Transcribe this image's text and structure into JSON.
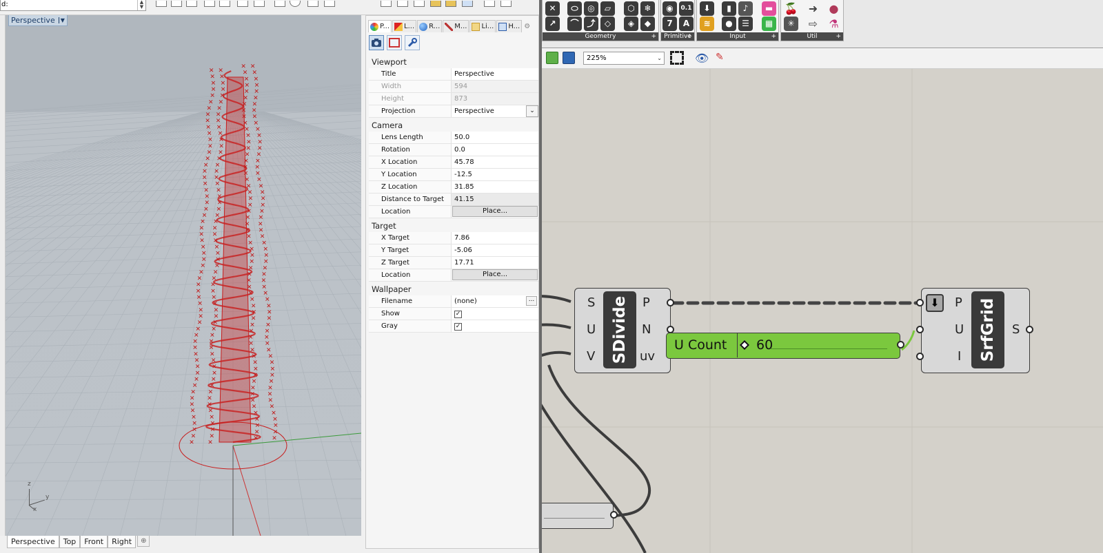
{
  "rhino": {
    "command_label": "d:",
    "viewport": {
      "title": "Perspective",
      "tabs": [
        "Perspective",
        "Top",
        "Front",
        "Right"
      ],
      "tab_add": "⊕",
      "axis": {
        "z": "z",
        "y": "y",
        "x": "x"
      }
    },
    "properties": {
      "tabs": [
        {
          "label": "P...",
          "icon": "properties-icon"
        },
        {
          "label": "L...",
          "icon": "layers-icon"
        },
        {
          "label": "R...",
          "icon": "render-icon"
        },
        {
          "label": "M...",
          "icon": "materials-icon"
        },
        {
          "label": "Li...",
          "icon": "libraries-icon"
        },
        {
          "label": "H...",
          "icon": "help-icon"
        }
      ],
      "sections": {
        "viewport": {
          "heading": "Viewport",
          "title_label": "Title",
          "title_value": "Perspective",
          "width_label": "Width",
          "width_value": "594",
          "height_label": "Height",
          "height_value": "873",
          "projection_label": "Projection",
          "projection_value": "Perspective"
        },
        "camera": {
          "heading": "Camera",
          "lens_label": "Lens Length",
          "lens_value": "50.0",
          "rotation_label": "Rotation",
          "rotation_value": "0.0",
          "xloc_label": "X Location",
          "xloc_value": "45.78",
          "yloc_label": "Y Location",
          "yloc_value": "-12.5",
          "zloc_label": "Z Location",
          "zloc_value": "31.85",
          "dist_label": "Distance to Target",
          "dist_value": "41.15",
          "loc_label": "Location",
          "loc_button": "Place..."
        },
        "target": {
          "heading": "Target",
          "xt_label": "X Target",
          "xt_value": "7.86",
          "yt_label": "Y Target",
          "yt_value": "-5.06",
          "zt_label": "Z Target",
          "zt_value": "17.71",
          "loc_label": "Location",
          "loc_button": "Place..."
        },
        "wallpaper": {
          "heading": "Wallpaper",
          "file_label": "Filename",
          "file_value": "(none)",
          "file_button": "...",
          "show_label": "Show",
          "show_checked": true,
          "gray_label": "Gray",
          "gray_checked": true
        }
      }
    }
  },
  "grasshopper": {
    "ribbon_groups": [
      "Geometry",
      "Primitive",
      "Input",
      "Util"
    ],
    "primitive_icons": [
      "0.1",
      "7",
      "A"
    ],
    "zoom": "225%",
    "components": {
      "sdivide": {
        "name": "SDivide",
        "inputs": [
          "S",
          "U",
          "V"
        ],
        "outputs": [
          "P",
          "N",
          "uv"
        ]
      },
      "srfgrid": {
        "name": "SrfGrid",
        "inputs": [
          "P",
          "U",
          "I"
        ],
        "outputs": [
          "S"
        ]
      }
    },
    "slider": {
      "name": "U Count",
      "value": "60"
    },
    "colors": {
      "canvas": "#d4d1ca",
      "slider": "#7bc83e",
      "helix": "#c81e1e"
    }
  }
}
